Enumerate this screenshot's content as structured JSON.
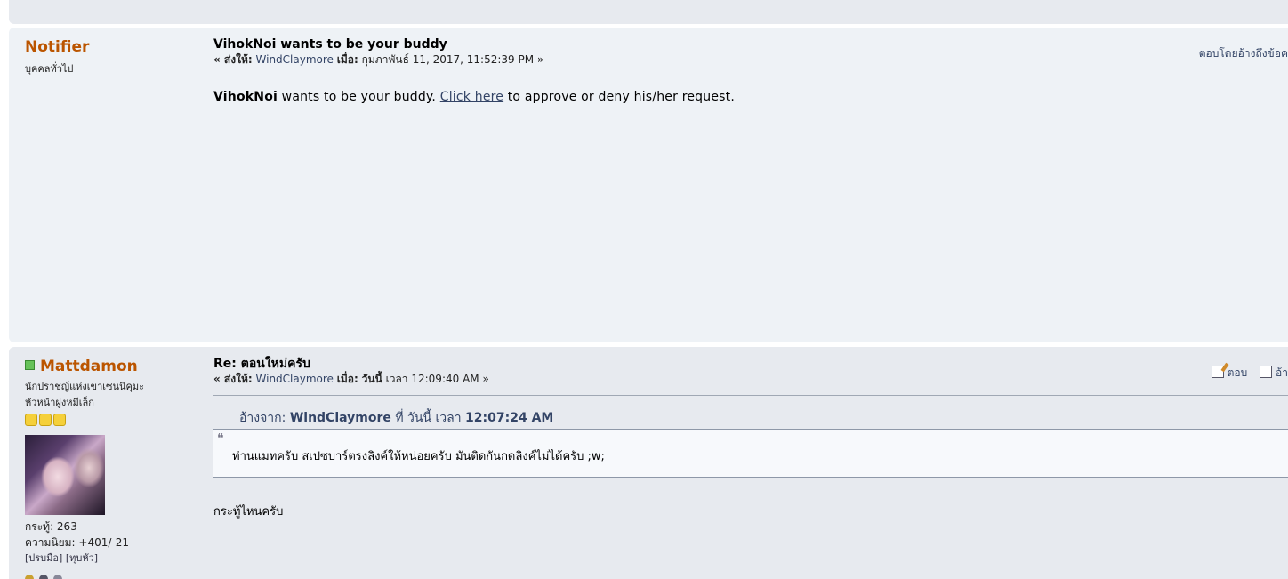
{
  "posts": [
    {
      "poster": {
        "name": "Notifier",
        "group": "บุคคลทั่วไป"
      },
      "subject": "VihokNoi wants to be your buddy",
      "meta": {
        "prefix": "« ส่งให้:",
        "recipient": "WindClaymore",
        "date_label": "เมื่อ:",
        "date": "กุมภาพันธ์ 11, 2017, 11:52:39 PM »"
      },
      "actions": {
        "quote_reply": "ตอบโดยอ้างถึงข้อค"
      },
      "body": {
        "user": "VihokNoi",
        "before_link": " wants to be your buddy. ",
        "link": "Click here",
        "after_link": " to approve or deny his/her request."
      }
    },
    {
      "poster": {
        "name": "Mattdamon",
        "title": "นักปราชญ์แห่งเขาเซนนิคุมะ",
        "group": "หัวหน้าฝูงหมีเล็ก",
        "stars": 3,
        "posts": "กระทู้: 263",
        "karma": "ความนิยม: +401/-21",
        "applaud": "[ปรบมือ]",
        "smite": "[ทุบหัว]"
      },
      "subject": "Re: ตอนใหม่ครับ",
      "meta": {
        "prefix": "« ส่งให้:",
        "recipient": "WindClaymore",
        "date_label": "เมื่อ:",
        "date_today": "วันนี้",
        "date": "เวลา 12:09:40 AM »"
      },
      "actions": {
        "reply": "ตอบ",
        "quote": "อ้า"
      },
      "quote": {
        "header_prefix": "อ้างจาก:",
        "author": "WindClaymore",
        "at": "ที่",
        "today": "วันนี้",
        "time_label": "เวลา",
        "time": "12:07:24 AM",
        "text": "ท่านแมทครับ สเปซบาร์ตรงลิงค์ให้หน่อยครับ มันติดกันกดลิงค์ไม่ได้ครับ ;w;"
      },
      "reply": "กระทู้ไหนครับ"
    }
  ],
  "colors": {
    "poster_name": "#bb5500",
    "link": "#334466",
    "online": "#66c25a"
  }
}
